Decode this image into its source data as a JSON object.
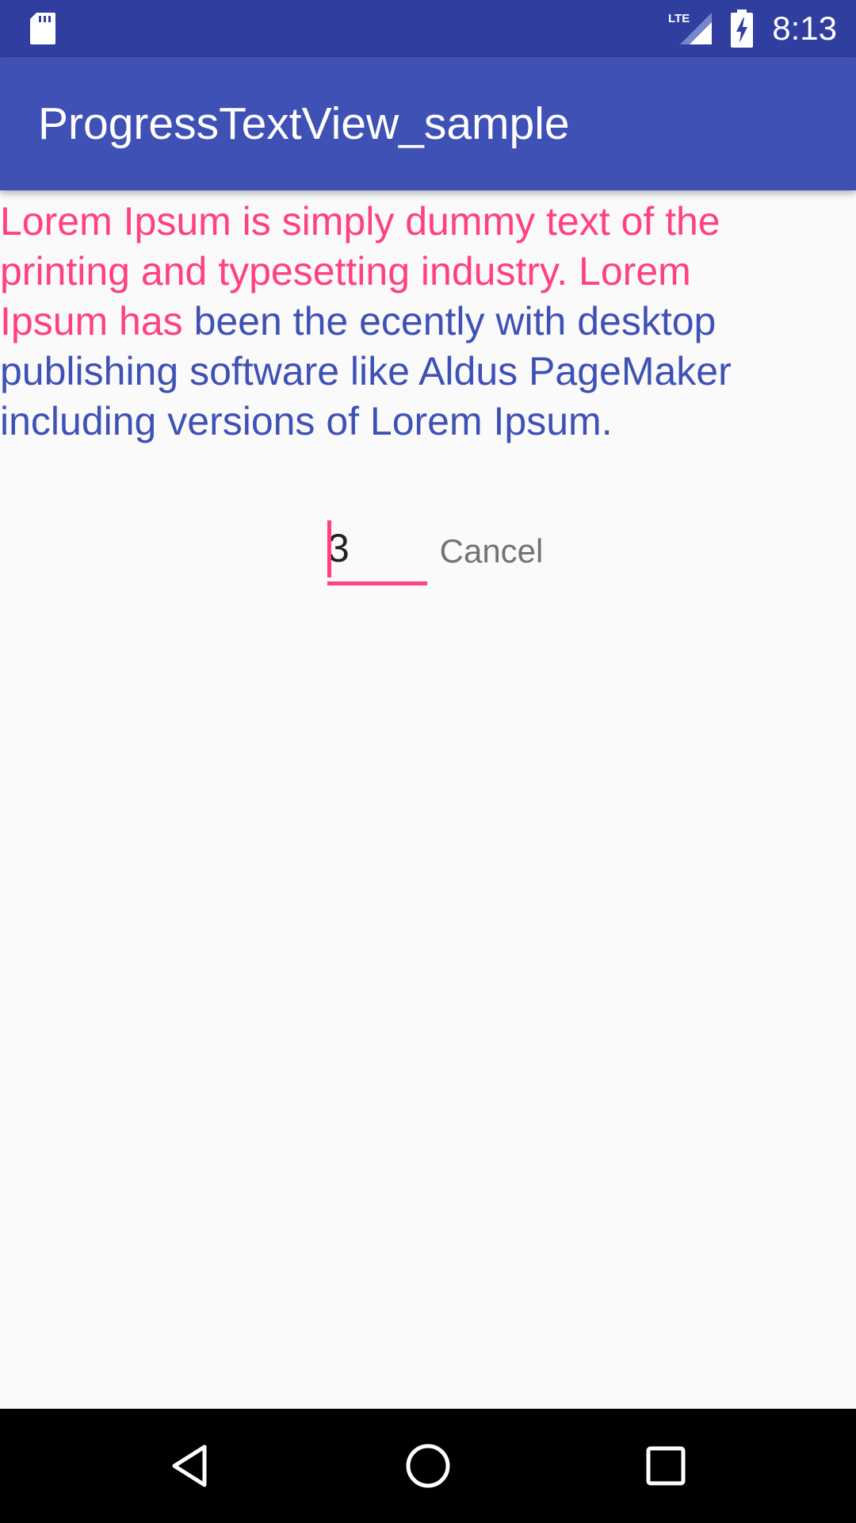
{
  "status_bar": {
    "time": "8:13",
    "network_label": "LTE",
    "icons": [
      "sd-card-icon",
      "lte-signal-icon",
      "battery-charging-icon"
    ]
  },
  "app_bar": {
    "title": "ProgressTextView_sample"
  },
  "progress_text": {
    "completed_text": "Lorem Ipsum is simply dummy text of the\nprinting and typesetting industry. Lorem\nIpsum has",
    "remaining_text": " been the ecently with desktop\npublishing software like Aldus PageMaker\nincluding versions of Lorem Ipsum.",
    "completed_color": "#ff4081",
    "remaining_color": "#3f51b5"
  },
  "controls": {
    "number_input_value": "3",
    "cancel_label": "Cancel"
  },
  "nav_bar": {
    "icons": [
      "back-icon",
      "home-icon",
      "recent-apps-icon"
    ]
  },
  "colors": {
    "status_bar": "#303f9f",
    "app_bar": "#3f51b5",
    "accent": "#ff4081",
    "background": "#fafafa"
  }
}
